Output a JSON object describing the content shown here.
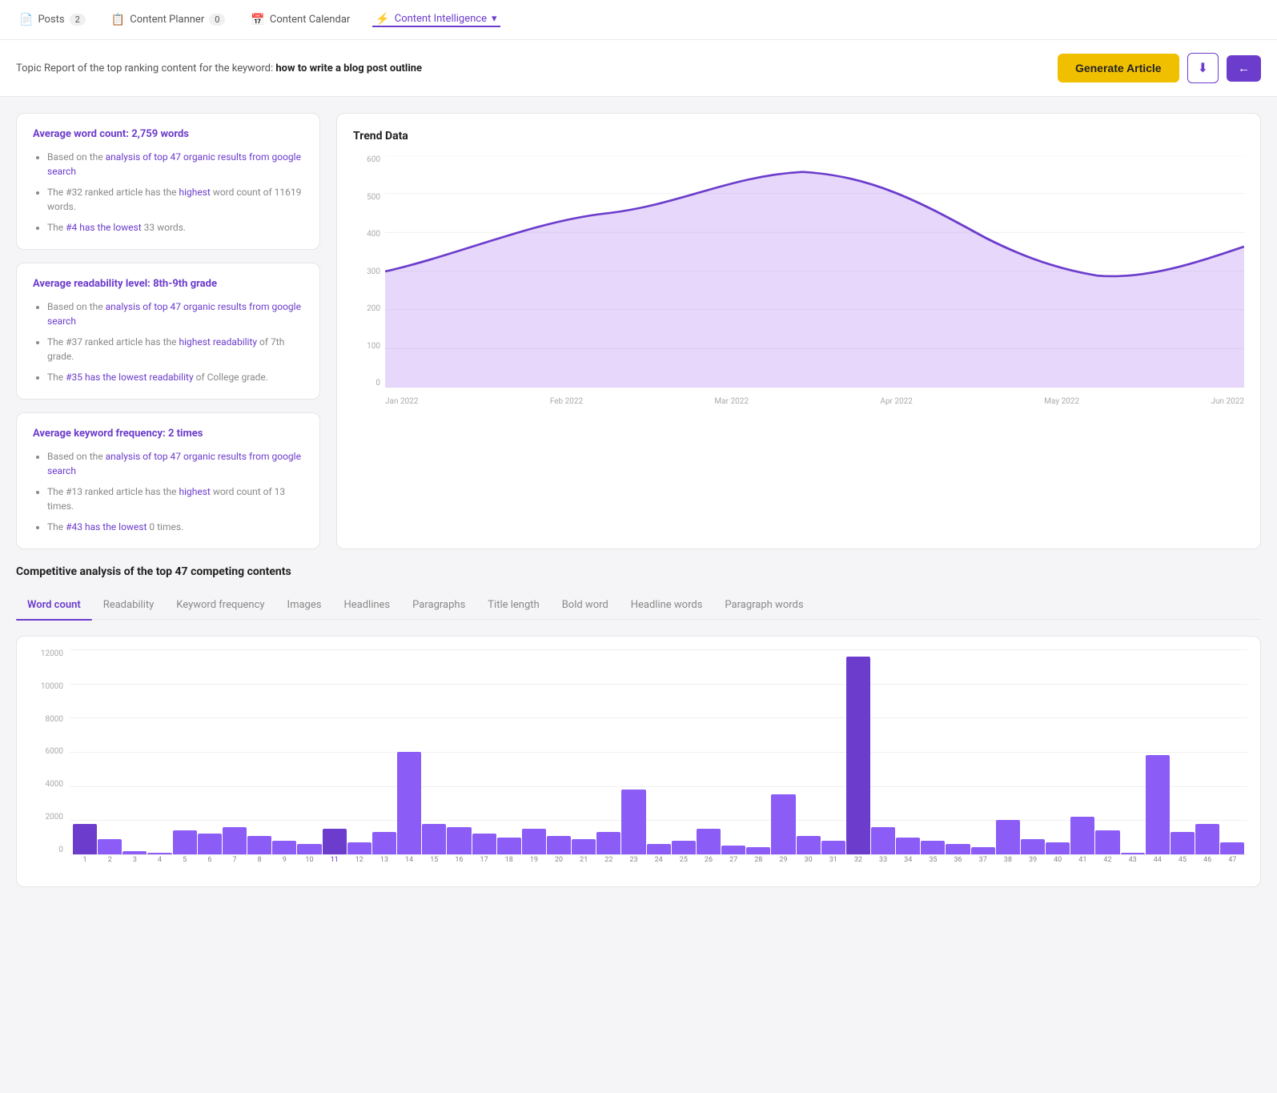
{
  "nav": {
    "items": [
      {
        "id": "posts",
        "label": "Posts",
        "badge": "2",
        "icon": "📄"
      },
      {
        "id": "content-planner",
        "label": "Content Planner",
        "badge": "0",
        "icon": "📋"
      },
      {
        "id": "content-calendar",
        "label": "Content Calendar",
        "icon": "📅"
      },
      {
        "id": "content-intelligence",
        "label": "Content Intelligence",
        "icon": "⚡",
        "dropdown": true,
        "active": true
      }
    ]
  },
  "header": {
    "topic_prefix": "Topic Report of the top ranking content for the keyword:",
    "keyword": "how to write a blog post outline",
    "generate_label": "Generate Article",
    "download_icon": "⬇",
    "back_icon": "←"
  },
  "stats_cards": [
    {
      "id": "word-count-card",
      "title_plain": "Average word count:",
      "title_value": "2,759 words",
      "bullets": [
        "Based on the analysis of top 47 organic results from google search",
        "The #32 ranked article has the highest word count of 11619 words.",
        "The #4 has the lowest 33 words."
      ]
    },
    {
      "id": "readability-card",
      "title_plain": "Average readability level:",
      "title_value": "8th-9th grade",
      "bullets": [
        "Based on the analysis of top 47 organic results from google search",
        "The #37 ranked article has the highest readability of 7th grade.",
        "The #35 has the lowest readability of College grade."
      ]
    },
    {
      "id": "keyword-freq-card",
      "title_plain": "Average keyword frequency:",
      "title_value": "2 times",
      "bullets": [
        "Based on the analysis of top 47 organic results from google search",
        "The #13 ranked article has the highest word count of 13 times.",
        "The #43 has the lowest 0 times."
      ]
    }
  ],
  "trend_chart": {
    "title": "Trend Data",
    "y_labels": [
      "600",
      "500",
      "400",
      "300",
      "200",
      "100",
      "0"
    ],
    "x_labels": [
      "Jan 2022",
      "Feb 2022",
      "Mar 2022",
      "Apr 2022",
      "May 2022",
      "Jun 2022"
    ]
  },
  "competitive": {
    "section_title": "Competitive analysis of the top 47 competing contents",
    "tabs": [
      {
        "id": "word-count",
        "label": "Word count",
        "active": true
      },
      {
        "id": "readability",
        "label": "Readability"
      },
      {
        "id": "keyword-frequency",
        "label": "Keyword frequency"
      },
      {
        "id": "images",
        "label": "Images"
      },
      {
        "id": "headlines",
        "label": "Headlines"
      },
      {
        "id": "paragraphs",
        "label": "Paragraphs"
      },
      {
        "id": "title-length",
        "label": "Title length"
      },
      {
        "id": "bold-word",
        "label": "Bold word"
      },
      {
        "id": "headline-words",
        "label": "Headline words"
      },
      {
        "id": "paragraph-words",
        "label": "Paragraph words"
      }
    ],
    "bar_chart": {
      "y_labels": [
        "12000",
        "10000",
        "8000",
        "6000",
        "4000",
        "2000",
        "0"
      ],
      "bars": [
        {
          "index": 1,
          "value": 1800,
          "highlight": true
        },
        {
          "index": 2,
          "value": 900
        },
        {
          "index": 3,
          "value": 200
        },
        {
          "index": 4,
          "value": 100
        },
        {
          "index": 5,
          "value": 1400
        },
        {
          "index": 6,
          "value": 1200
        },
        {
          "index": 7,
          "value": 1600
        },
        {
          "index": 8,
          "value": 1100
        },
        {
          "index": 9,
          "value": 800
        },
        {
          "index": 10,
          "value": 600
        },
        {
          "index": 11,
          "value": 1500,
          "highlight": true
        },
        {
          "index": 12,
          "value": 700
        },
        {
          "index": 13,
          "value": 1300
        },
        {
          "index": 14,
          "value": 6000
        },
        {
          "index": 15,
          "value": 1800
        },
        {
          "index": 16,
          "value": 1600
        },
        {
          "index": 17,
          "value": 1200
        },
        {
          "index": 18,
          "value": 1000
        },
        {
          "index": 19,
          "value": 1500
        },
        {
          "index": 20,
          "value": 1100
        },
        {
          "index": 21,
          "value": 900
        },
        {
          "index": 22,
          "value": 1300
        },
        {
          "index": 23,
          "value": 3800
        },
        {
          "index": 24,
          "value": 600
        },
        {
          "index": 25,
          "value": 800
        },
        {
          "index": 26,
          "value": 1500
        },
        {
          "index": 27,
          "value": 500
        },
        {
          "index": 28,
          "value": 400
        },
        {
          "index": 29,
          "value": 3500
        },
        {
          "index": 30,
          "value": 1100
        },
        {
          "index": 31,
          "value": 800
        },
        {
          "index": 32,
          "value": 11600,
          "highlight": true
        },
        {
          "index": 33,
          "value": 1600
        },
        {
          "index": 34,
          "value": 1000
        },
        {
          "index": 35,
          "value": 800
        },
        {
          "index": 36,
          "value": 600
        },
        {
          "index": 37,
          "value": 400
        },
        {
          "index": 38,
          "value": 2000
        },
        {
          "index": 39,
          "value": 900
        },
        {
          "index": 40,
          "value": 700
        },
        {
          "index": 41,
          "value": 2200
        },
        {
          "index": 42,
          "value": 1400
        },
        {
          "index": 43,
          "value": 100
        },
        {
          "index": 44,
          "value": 5800
        },
        {
          "index": 45,
          "value": 1300
        },
        {
          "index": 46,
          "value": 1800
        },
        {
          "index": 47,
          "value": 700
        }
      ],
      "max_value": 12000
    }
  },
  "colors": {
    "purple": "#6c3ccc",
    "purple_light": "#8b5cf6",
    "yellow": "#f0c000",
    "link": "#6c3ccc"
  }
}
